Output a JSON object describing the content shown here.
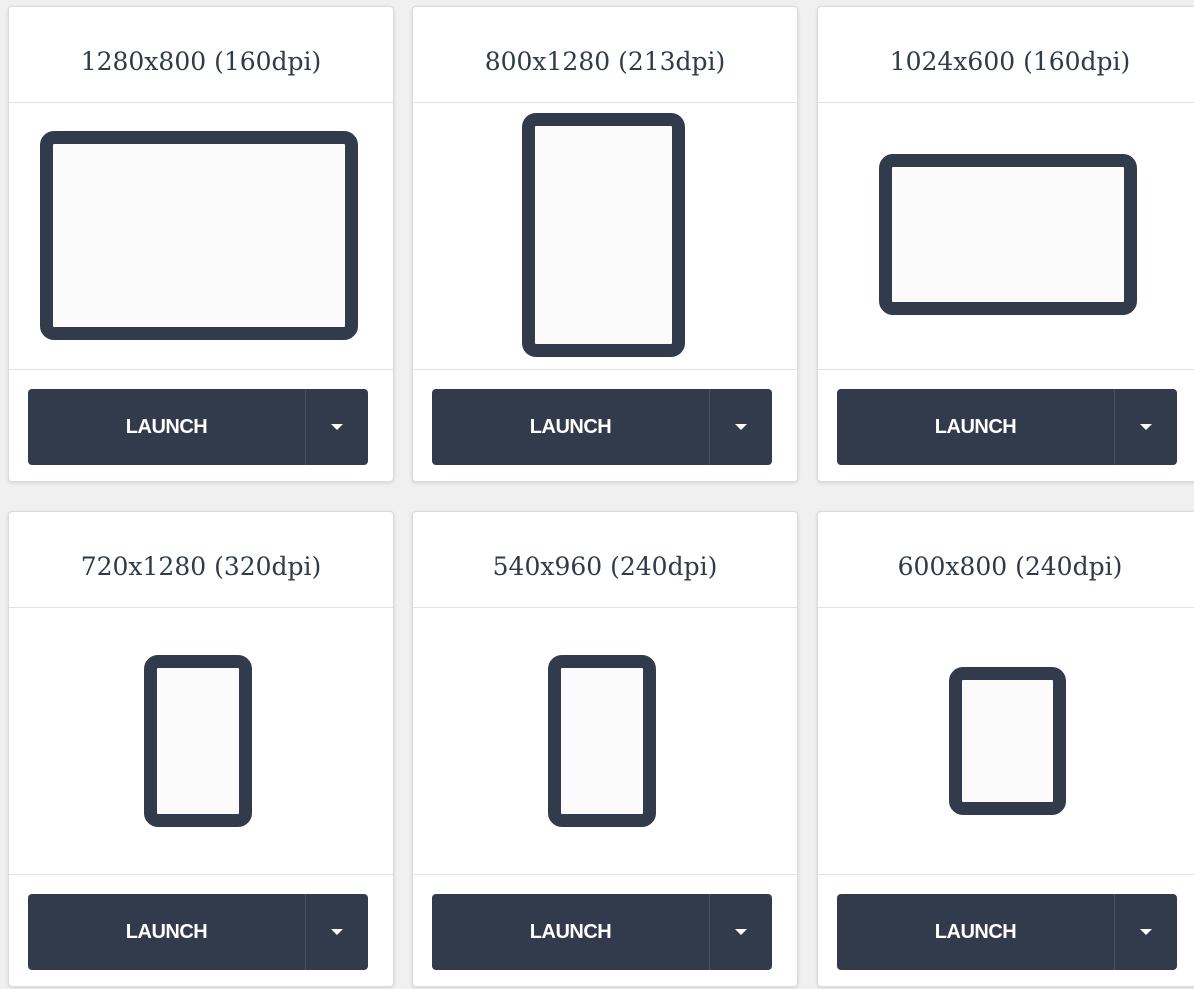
{
  "devices": [
    {
      "title": "1280x800 (160dpi)",
      "launch_label": "LAUNCH"
    },
    {
      "title": "800x1280 (213dpi)",
      "launch_label": "LAUNCH"
    },
    {
      "title": "1024x600 (160dpi)",
      "launch_label": "LAUNCH"
    },
    {
      "title": "720x1280 (320dpi)",
      "launch_label": "LAUNCH"
    },
    {
      "title": "540x960 (240dpi)",
      "launch_label": "LAUNCH"
    },
    {
      "title": "600x800 (240dpi)",
      "launch_label": "LAUNCH"
    }
  ],
  "colors": {
    "device_frame": "#323b4c",
    "button_bg": "#323b4c",
    "button_text": "#ffffff",
    "page_bg": "#f0f0f0"
  },
  "icons": {
    "device": "tablet-outline-icon",
    "dropdown": "caret-down-icon"
  }
}
